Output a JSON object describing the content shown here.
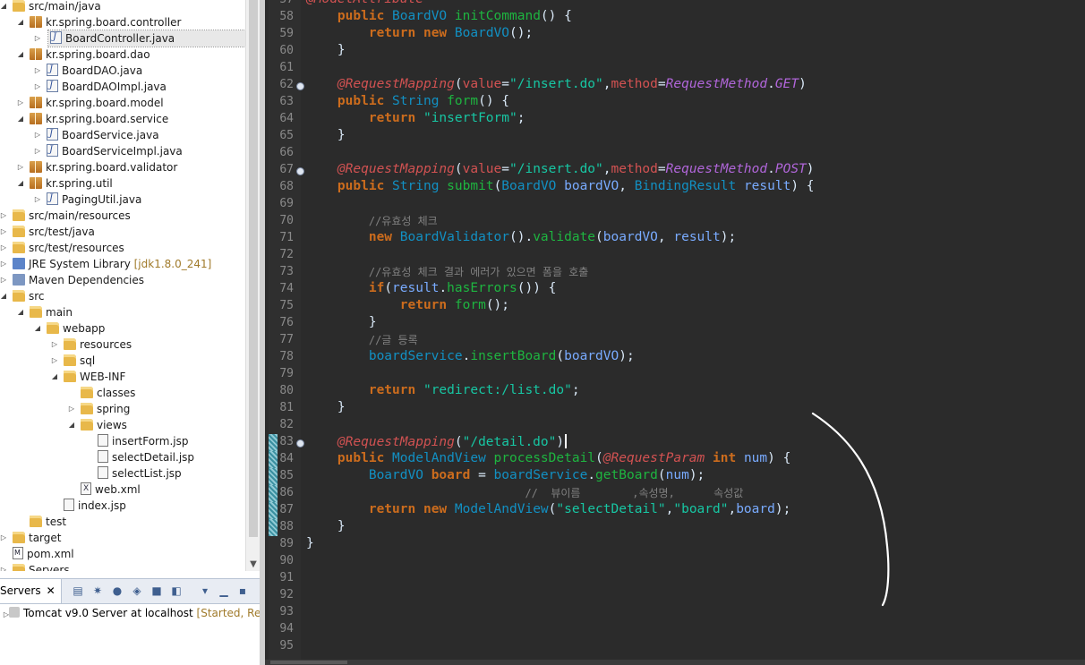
{
  "explorer": {
    "items": [
      {
        "label": "src/main/java",
        "depth": 0,
        "icon": "folder-icon",
        "twisty": "open"
      },
      {
        "label": "kr.spring.board.controller",
        "depth": 1,
        "icon": "package-icon",
        "twisty": "open"
      },
      {
        "label": "BoardController.java",
        "depth": 2,
        "icon": "java-file-icon",
        "twisty": "closed",
        "selected": true
      },
      {
        "label": "kr.spring.board.dao",
        "depth": 1,
        "icon": "package-icon",
        "twisty": "open"
      },
      {
        "label": "BoardDAO.java",
        "depth": 2,
        "icon": "java-file-icon",
        "twisty": "closed"
      },
      {
        "label": "BoardDAOImpl.java",
        "depth": 2,
        "icon": "java-file-icon",
        "twisty": "closed"
      },
      {
        "label": "kr.spring.board.model",
        "depth": 1,
        "icon": "package-icon",
        "twisty": "closed"
      },
      {
        "label": "kr.spring.board.service",
        "depth": 1,
        "icon": "package-icon",
        "twisty": "open"
      },
      {
        "label": "BoardService.java",
        "depth": 2,
        "icon": "java-file-icon",
        "twisty": "closed"
      },
      {
        "label": "BoardServiceImpl.java",
        "depth": 2,
        "icon": "java-file-icon",
        "twisty": "closed"
      },
      {
        "label": "kr.spring.board.validator",
        "depth": 1,
        "icon": "package-icon",
        "twisty": "closed"
      },
      {
        "label": "kr.spring.util",
        "depth": 1,
        "icon": "package-icon",
        "twisty": "open"
      },
      {
        "label": "PagingUtil.java",
        "depth": 2,
        "icon": "java-file-icon",
        "twisty": "closed"
      },
      {
        "label": "src/main/resources",
        "depth": 0,
        "icon": "folder-icon",
        "twisty": "closed"
      },
      {
        "label": "src/test/java",
        "depth": 0,
        "icon": "folder-icon",
        "twisty": "closed"
      },
      {
        "label": "src/test/resources",
        "depth": 0,
        "icon": "folder-icon",
        "twisty": "closed"
      },
      {
        "label": "JRE System Library",
        "suffix": "[jdk1.8.0_241]",
        "depth": 0,
        "icon": "library-icon",
        "twisty": "closed"
      },
      {
        "label": "Maven Dependencies",
        "depth": 0,
        "icon": "maven-icon",
        "twisty": "closed"
      },
      {
        "label": "src",
        "depth": 0,
        "icon": "folder-icon",
        "twisty": "open"
      },
      {
        "label": "main",
        "depth": 1,
        "icon": "folder-icon",
        "twisty": "open"
      },
      {
        "label": "webapp",
        "depth": 2,
        "icon": "folder-icon",
        "twisty": "open"
      },
      {
        "label": "resources",
        "depth": 3,
        "icon": "folder-icon",
        "twisty": "closed"
      },
      {
        "label": "sql",
        "depth": 3,
        "icon": "folder-icon",
        "twisty": "closed"
      },
      {
        "label": "WEB-INF",
        "depth": 3,
        "icon": "folder-icon",
        "twisty": "open"
      },
      {
        "label": "classes",
        "depth": 4,
        "icon": "folder-icon",
        "twisty": "none"
      },
      {
        "label": "spring",
        "depth": 4,
        "icon": "folder-icon",
        "twisty": "closed"
      },
      {
        "label": "views",
        "depth": 4,
        "icon": "folder-icon",
        "twisty": "open"
      },
      {
        "label": "insertForm.jsp",
        "depth": 5,
        "icon": "jsp-file-icon",
        "twisty": "none"
      },
      {
        "label": "selectDetail.jsp",
        "depth": 5,
        "icon": "jsp-file-icon",
        "twisty": "none"
      },
      {
        "label": "selectList.jsp",
        "depth": 5,
        "icon": "jsp-file-icon",
        "twisty": "none"
      },
      {
        "label": "web.xml",
        "depth": 4,
        "icon": "xml-file-icon",
        "twisty": "none"
      },
      {
        "label": "index.jsp",
        "depth": 3,
        "icon": "jsp-file-icon",
        "twisty": "none"
      },
      {
        "label": "test",
        "depth": 1,
        "icon": "folder-icon",
        "twisty": "none"
      },
      {
        "label": "target",
        "depth": 0,
        "icon": "folder-icon",
        "twisty": "closed"
      },
      {
        "label": "pom.xml",
        "depth": 0,
        "icon": "maven-pom-icon",
        "twisty": "none"
      },
      {
        "label": "Servers",
        "depth": 0,
        "icon": "folder-icon",
        "twisty": "closed"
      }
    ]
  },
  "servers_view": {
    "tab_label": "Servers",
    "server_name": "Tomcat v9.0 Server at localhost",
    "server_status": "[Started, Restart]"
  },
  "editor": {
    "lines": [
      {
        "n": "57",
        "fold": false,
        "changed": false,
        "tokens": [
          [
            "an",
            "@ModelAttribute"
          ]
        ]
      },
      {
        "n": "58",
        "fold": false,
        "changed": false,
        "tokens": [
          [
            "df",
            "    "
          ],
          [
            "kw",
            "public"
          ],
          [
            "df",
            " "
          ],
          [
            "ty",
            "BoardVO"
          ],
          [
            "df",
            " "
          ],
          [
            "fn",
            "initCommand"
          ],
          [
            "df",
            "() {"
          ]
        ]
      },
      {
        "n": "59",
        "fold": false,
        "changed": false,
        "tokens": [
          [
            "df",
            "        "
          ],
          [
            "kw",
            "return"
          ],
          [
            "df",
            " "
          ],
          [
            "kw",
            "new"
          ],
          [
            "df",
            " "
          ],
          [
            "ty",
            "BoardVO"
          ],
          [
            "df",
            "();"
          ]
        ]
      },
      {
        "n": "60",
        "fold": false,
        "changed": false,
        "tokens": [
          [
            "df",
            "    }"
          ]
        ]
      },
      {
        "n": "61",
        "fold": false,
        "changed": false,
        "tokens": []
      },
      {
        "n": "62",
        "fold": true,
        "changed": false,
        "tokens": [
          [
            "df",
            "    "
          ],
          [
            "an",
            "@RequestMapping"
          ],
          [
            "df",
            "("
          ],
          [
            "at",
            "value"
          ],
          [
            "df",
            "="
          ],
          [
            "st",
            "\"/insert.do\""
          ],
          [
            "df",
            ","
          ],
          [
            "at",
            "method"
          ],
          [
            "df",
            "="
          ],
          [
            "cl",
            "RequestMethod"
          ],
          [
            "df",
            "."
          ],
          [
            "cl",
            "GET"
          ],
          [
            "df",
            ")"
          ]
        ]
      },
      {
        "n": "63",
        "fold": false,
        "changed": false,
        "tokens": [
          [
            "df",
            "    "
          ],
          [
            "kw",
            "public"
          ],
          [
            "df",
            " "
          ],
          [
            "ty",
            "String"
          ],
          [
            "df",
            " "
          ],
          [
            "fn",
            "form"
          ],
          [
            "df",
            "() {"
          ]
        ]
      },
      {
        "n": "64",
        "fold": false,
        "changed": false,
        "tokens": [
          [
            "df",
            "        "
          ],
          [
            "kw",
            "return"
          ],
          [
            "df",
            " "
          ],
          [
            "st",
            "\"insertForm\""
          ],
          [
            "df",
            ";"
          ]
        ]
      },
      {
        "n": "65",
        "fold": false,
        "changed": false,
        "tokens": [
          [
            "df",
            "    }"
          ]
        ]
      },
      {
        "n": "66",
        "fold": false,
        "changed": false,
        "tokens": []
      },
      {
        "n": "67",
        "fold": true,
        "changed": false,
        "tokens": [
          [
            "df",
            "    "
          ],
          [
            "an",
            "@RequestMapping"
          ],
          [
            "df",
            "("
          ],
          [
            "at",
            "value"
          ],
          [
            "df",
            "="
          ],
          [
            "st",
            "\"/insert.do\""
          ],
          [
            "df",
            ","
          ],
          [
            "at",
            "method"
          ],
          [
            "df",
            "="
          ],
          [
            "cl",
            "RequestMethod"
          ],
          [
            "df",
            "."
          ],
          [
            "cl",
            "POST"
          ],
          [
            "df",
            ")"
          ]
        ]
      },
      {
        "n": "68",
        "fold": false,
        "changed": false,
        "tokens": [
          [
            "df",
            "    "
          ],
          [
            "kw",
            "public"
          ],
          [
            "df",
            " "
          ],
          [
            "ty",
            "String"
          ],
          [
            "df",
            " "
          ],
          [
            "fn",
            "submit"
          ],
          [
            "df",
            "("
          ],
          [
            "ty",
            "BoardVO"
          ],
          [
            "df",
            " "
          ],
          [
            "vr",
            "boardVO"
          ],
          [
            "df",
            ", "
          ],
          [
            "ty",
            "BindingResult"
          ],
          [
            "df",
            " "
          ],
          [
            "vr",
            "result"
          ],
          [
            "df",
            ") {"
          ]
        ]
      },
      {
        "n": "69",
        "fold": false,
        "changed": false,
        "tokens": []
      },
      {
        "n": "70",
        "fold": false,
        "changed": false,
        "tokens": [
          [
            "df",
            "        "
          ],
          [
            "cm",
            "//유효성 체크"
          ]
        ]
      },
      {
        "n": "71",
        "fold": false,
        "changed": false,
        "tokens": [
          [
            "df",
            "        "
          ],
          [
            "kw",
            "new"
          ],
          [
            "df",
            " "
          ],
          [
            "ty",
            "BoardValidator"
          ],
          [
            "df",
            "()."
          ],
          [
            "fn",
            "validate"
          ],
          [
            "df",
            "("
          ],
          [
            "vr",
            "boardVO"
          ],
          [
            "df",
            ", "
          ],
          [
            "vr",
            "result"
          ],
          [
            "df",
            ");"
          ]
        ]
      },
      {
        "n": "72",
        "fold": false,
        "changed": false,
        "tokens": []
      },
      {
        "n": "73",
        "fold": false,
        "changed": false,
        "tokens": [
          [
            "df",
            "        "
          ],
          [
            "cm",
            "//유효성 체크 결과 에러가 있으면 폼을 호출"
          ]
        ]
      },
      {
        "n": "74",
        "fold": false,
        "changed": false,
        "tokens": [
          [
            "df",
            "        "
          ],
          [
            "kw",
            "if"
          ],
          [
            "df",
            "("
          ],
          [
            "vr",
            "result"
          ],
          [
            "df",
            "."
          ],
          [
            "fn",
            "hasErrors"
          ],
          [
            "df",
            "()) {"
          ]
        ]
      },
      {
        "n": "75",
        "fold": false,
        "changed": false,
        "tokens": [
          [
            "df",
            "            "
          ],
          [
            "kw",
            "return"
          ],
          [
            "df",
            " "
          ],
          [
            "fn",
            "form"
          ],
          [
            "df",
            "();"
          ]
        ]
      },
      {
        "n": "76",
        "fold": false,
        "changed": false,
        "tokens": [
          [
            "df",
            "        }"
          ]
        ]
      },
      {
        "n": "77",
        "fold": false,
        "changed": false,
        "tokens": [
          [
            "df",
            "        "
          ],
          [
            "cm",
            "//글 등록"
          ]
        ]
      },
      {
        "n": "78",
        "fold": false,
        "changed": false,
        "tokens": [
          [
            "df",
            "        "
          ],
          [
            "ty",
            "boardService"
          ],
          [
            "df",
            "."
          ],
          [
            "fn",
            "insertBoard"
          ],
          [
            "df",
            "("
          ],
          [
            "vr",
            "boardVO"
          ],
          [
            "df",
            ");"
          ]
        ]
      },
      {
        "n": "79",
        "fold": false,
        "changed": false,
        "tokens": []
      },
      {
        "n": "80",
        "fold": false,
        "changed": false,
        "tokens": [
          [
            "df",
            "        "
          ],
          [
            "kw",
            "return"
          ],
          [
            "df",
            " "
          ],
          [
            "st",
            "\"redirect:/list.do\""
          ],
          [
            "df",
            ";"
          ]
        ]
      },
      {
        "n": "81",
        "fold": false,
        "changed": false,
        "tokens": [
          [
            "df",
            "    }"
          ]
        ]
      },
      {
        "n": "82",
        "fold": false,
        "changed": false,
        "tokens": []
      },
      {
        "n": "83",
        "fold": true,
        "changed": true,
        "tokens": [
          [
            "df",
            "    "
          ],
          [
            "an",
            "@RequestMapping"
          ],
          [
            "df",
            "("
          ],
          [
            "st",
            "\"/detail.do\""
          ],
          [
            "df",
            ")"
          ],
          [
            "cursor",
            ""
          ]
        ]
      },
      {
        "n": "84",
        "fold": false,
        "changed": true,
        "tokens": [
          [
            "df",
            "    "
          ],
          [
            "kw",
            "public"
          ],
          [
            "df",
            " "
          ],
          [
            "ty",
            "ModelAndView"
          ],
          [
            "df",
            " "
          ],
          [
            "fn",
            "processDetail"
          ],
          [
            "df",
            "("
          ],
          [
            "an",
            "@RequestParam"
          ],
          [
            "df",
            " "
          ],
          [
            "kw",
            "int"
          ],
          [
            "df",
            " "
          ],
          [
            "vr",
            "num"
          ],
          [
            "df",
            ") {"
          ]
        ]
      },
      {
        "n": "85",
        "fold": false,
        "changed": true,
        "tokens": [
          [
            "df",
            "        "
          ],
          [
            "ty",
            "BoardVO"
          ],
          [
            "df",
            " "
          ],
          [
            "kw",
            "board"
          ],
          [
            "df",
            " = "
          ],
          [
            "ty",
            "boardService"
          ],
          [
            "df",
            "."
          ],
          [
            "fn",
            "getBoard"
          ],
          [
            "df",
            "("
          ],
          [
            "vr",
            "num"
          ],
          [
            "df",
            ");"
          ]
        ]
      },
      {
        "n": "86",
        "fold": false,
        "changed": true,
        "tokens": [
          [
            "df",
            "                            "
          ],
          [
            "cm",
            "//  뷰이름        ,속성명,      속성값"
          ]
        ]
      },
      {
        "n": "87",
        "fold": false,
        "changed": true,
        "tokens": [
          [
            "df",
            "        "
          ],
          [
            "kw",
            "return"
          ],
          [
            "df",
            " "
          ],
          [
            "kw",
            "new"
          ],
          [
            "df",
            " "
          ],
          [
            "ty",
            "ModelAndView"
          ],
          [
            "df",
            "("
          ],
          [
            "st",
            "\"selectDetail\""
          ],
          [
            "df",
            ","
          ],
          [
            "st",
            "\"board\""
          ],
          [
            "df",
            ","
          ],
          [
            "vr",
            "board"
          ],
          [
            "df",
            ");"
          ]
        ]
      },
      {
        "n": "88",
        "fold": false,
        "changed": true,
        "tokens": [
          [
            "df",
            "    }"
          ]
        ]
      },
      {
        "n": "89",
        "fold": false,
        "changed": false,
        "tokens": [
          [
            "df",
            "}"
          ]
        ]
      },
      {
        "n": "90",
        "fold": false,
        "changed": false,
        "tokens": []
      },
      {
        "n": "91",
        "fold": false,
        "changed": false,
        "tokens": []
      },
      {
        "n": "92",
        "fold": false,
        "changed": false,
        "tokens": []
      },
      {
        "n": "93",
        "fold": false,
        "changed": false,
        "tokens": []
      },
      {
        "n": "94",
        "fold": false,
        "changed": false,
        "tokens": []
      },
      {
        "n": "95",
        "fold": false,
        "changed": false,
        "tokens": []
      }
    ]
  },
  "colors": {
    "editor_bg": "#2b2b2b",
    "keyword": "#cc6c1d",
    "annotation": "#d25252",
    "string": "#17c6a3",
    "type": "#1290c3",
    "method": "#1eb540",
    "comment": "#808080"
  }
}
